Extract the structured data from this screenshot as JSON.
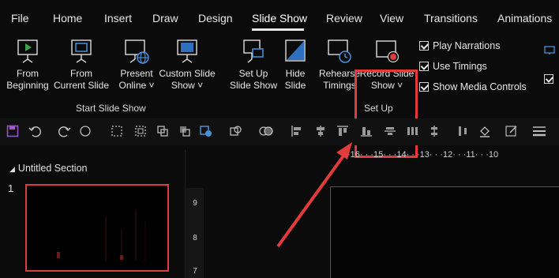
{
  "menu": {
    "items": [
      "File",
      "Home",
      "Insert",
      "Draw",
      "Design",
      "Slide Show",
      "Review",
      "View",
      "Transitions",
      "Animations"
    ],
    "active": "Slide Show"
  },
  "ribbon": {
    "from_beginning": [
      "From",
      "Beginning"
    ],
    "from_current": [
      "From",
      "Current Slide"
    ],
    "present_online": [
      "Present",
      "Online ˅"
    ],
    "custom_show": [
      "Custom Slide",
      "Show ˅"
    ],
    "start_group_label": "Start Slide Show",
    "setup_show": [
      "Set Up",
      "Slide Show"
    ],
    "hide_slide": [
      "Hide",
      "Slide"
    ],
    "rehearse": [
      "Rehearse",
      "Timings"
    ],
    "record_show": [
      "Record Slide",
      "Show ˅"
    ],
    "setup_group_label": "Set Up",
    "checkboxes": [
      "Play Narrations",
      "Use Timings",
      "Show Media Controls"
    ]
  },
  "slides_pane": {
    "section": "Untitled Section",
    "slide_number": "1"
  },
  "ruler": {
    "horizontal": "·16· · ·15· · ·14· · ·13· · ·12· · ·11· · ·10",
    "vertical": [
      "9",
      "8",
      "7"
    ]
  },
  "colors": {
    "highlight": "#e23b3b",
    "accent_blue": "#4a90d9",
    "background": "#0b0b0b"
  }
}
